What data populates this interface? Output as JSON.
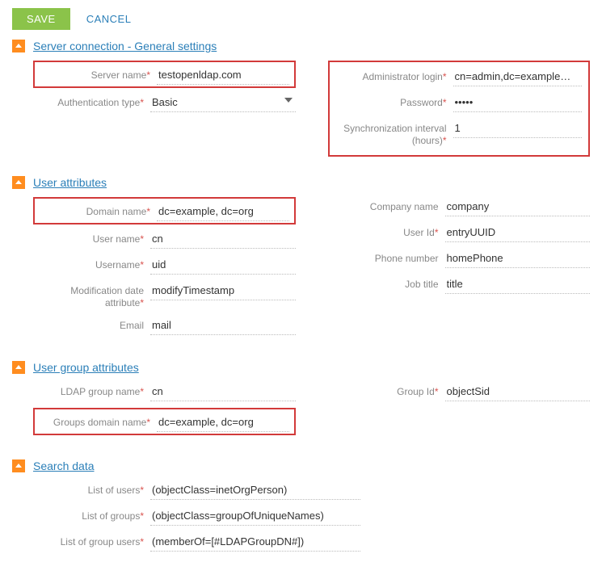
{
  "toolbar": {
    "save": "SAVE",
    "cancel": "CANCEL"
  },
  "sections": {
    "server": {
      "title": "Server connection - General settings",
      "left": {
        "serverName": {
          "label": "Server name",
          "value": "testopenldap.com"
        },
        "authType": {
          "label": "Authentication type",
          "value": "Basic"
        }
      },
      "right": {
        "adminLogin": {
          "label": "Administrator login",
          "value": "cn=admin,dc=example…"
        },
        "password": {
          "label": "Password",
          "value": "•••••"
        },
        "syncInterval": {
          "label": "Synchronization interval (hours)",
          "value": "1"
        }
      }
    },
    "userAttrs": {
      "title": "User attributes",
      "left": {
        "domainName": {
          "label": "Domain name",
          "value": "dc=example, dc=org"
        },
        "userName": {
          "label": "User name",
          "value": "cn"
        },
        "username2": {
          "label": "Username",
          "value": "uid"
        },
        "modDate": {
          "label": "Modification date attribute",
          "value": "modifyTimestamp"
        },
        "email": {
          "label": "Email",
          "value": "mail"
        }
      },
      "right": {
        "companyName": {
          "label": "Company name",
          "value": "company"
        },
        "userId": {
          "label": "User Id",
          "value": "entryUUID"
        },
        "phone": {
          "label": "Phone number",
          "value": "homePhone"
        },
        "jobTitle": {
          "label": "Job title",
          "value": "title"
        }
      }
    },
    "groupAttrs": {
      "title": "User group attributes",
      "left": {
        "ldapGroupName": {
          "label": "LDAP group name",
          "value": "cn"
        },
        "groupsDomainName": {
          "label": "Groups domain name",
          "value": "dc=example, dc=org"
        }
      },
      "right": {
        "groupId": {
          "label": "Group Id",
          "value": "objectSid"
        }
      }
    },
    "searchData": {
      "title": "Search data",
      "listUsers": {
        "label": "List of users",
        "value": "(objectClass=inetOrgPerson)"
      },
      "listGroups": {
        "label": "List of groups",
        "value": "(objectClass=groupOfUniqueNames)"
      },
      "listGroupUsers": {
        "label": "List of group users",
        "value": "(memberOf=[#LDAPGroupDN#])"
      }
    }
  }
}
